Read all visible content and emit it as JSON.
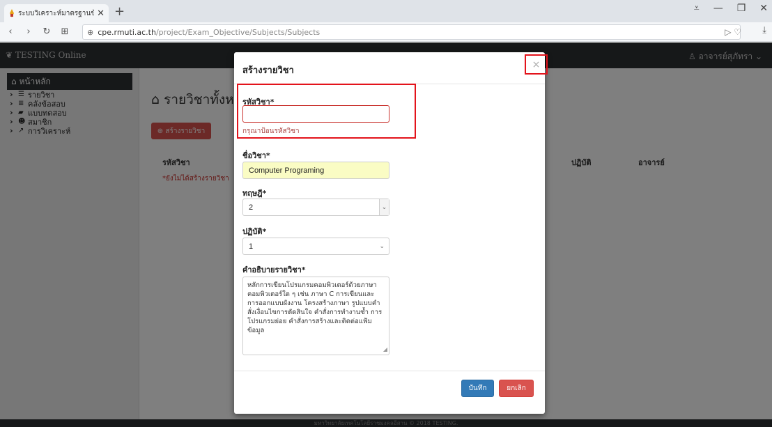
{
  "browser": {
    "tab_title": "ระบบวิเคราะห์มาตรฐานข้อสอบ",
    "tab_close": "✕",
    "new_tab": "+",
    "url_host": "cpe.rmuti.ac.th",
    "url_path": "/project/Exam_Objective/Subjects/Subjects"
  },
  "app": {
    "brand": "TESTING Online",
    "user": "อาจารย์สุภัทรา",
    "sidebar": {
      "home": "หน้าหลัก",
      "items": [
        {
          "label": "รายวิชา",
          "icon": "list-icon"
        },
        {
          "label": "คลังข้อสอบ",
          "icon": "database-icon"
        },
        {
          "label": "แบบทดสอบ",
          "icon": "book-icon"
        },
        {
          "label": "สมาชิก",
          "icon": "users-icon"
        },
        {
          "label": "การวิเคราะห์",
          "icon": "line-chart-icon"
        }
      ]
    },
    "page_title": "รายวิชาทั้งหมด",
    "create_button": "สร้างรายวิชา",
    "table": {
      "headers": [
        "รหัสวิชา",
        "ปฏิบัติ",
        "อาจารย์"
      ],
      "empty_note": "*ยังไม่ได้สร้างรายวิชา"
    },
    "footer": "มหาวิทยาลัยเทคโนโลยีราชมงคลอีสาน © 2018 TESTING."
  },
  "modal": {
    "title": "สร้างรายวิชา",
    "close": "×",
    "code_label": "รหัสวิชา*",
    "code_value": "",
    "code_help": "กรุณาป้อนรหัสวิชา",
    "name_label": "ชื่อวิชา*",
    "name_value": "Computer Programing",
    "theory_label": "ทฤษฎี*",
    "theory_value": "2",
    "practice_label": "ปฏิบัติ*",
    "practice_value": "1",
    "desc_label": "คำอธิบายรายวิชา*",
    "desc_value": "หลักการเขียนโปรแกรมคอมพิวเตอร์ด้วยภาษาคอมพิวเตอร์ใด ๆ เช่น ภาษา C การเขียนและการออกแบบผังงาน โครงสร้างภาษา รูปแบบคำสั่งเงื่อนไขการตัดสินใจ คำสั่งการทำงานซ้ำ การโปรแกรมย่อย คำสั่งการสร้างและติดต่อแฟ้มข้อมูล",
    "save": "บันทึก",
    "cancel": "ยกเลิก"
  }
}
